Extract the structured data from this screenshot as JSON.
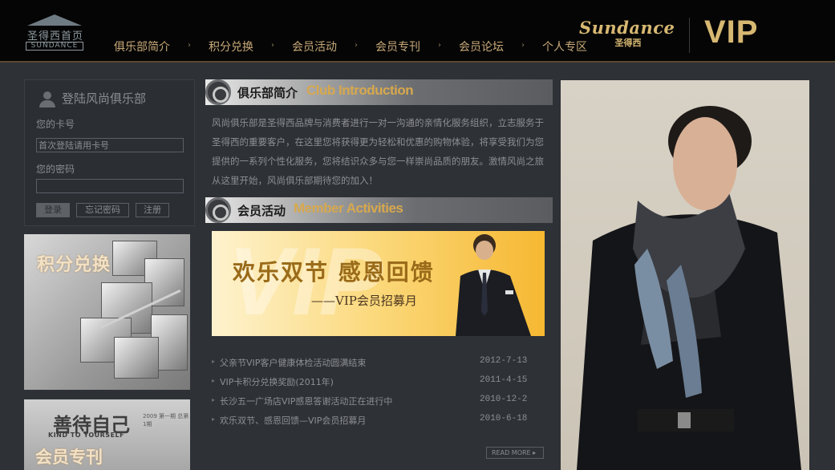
{
  "header": {
    "logo": {
      "cn": "圣得西首页",
      "en": "SUNDANCE"
    },
    "nav": [
      "俱乐部简介",
      "积分兑换",
      "会员活动",
      "会员专刊",
      "会员论坛",
      "个人专区"
    ],
    "nav_separator": "›",
    "brand": {
      "script": "Sundance",
      "sub": "圣得西"
    },
    "vip": "VIP"
  },
  "login": {
    "title": "登陆风尚俱乐部",
    "card_label": "您的卡号",
    "card_placeholder": "首次登陆请用卡号",
    "password_label": "您的密码",
    "login_button": "登录",
    "forgot_button": "忘记密码",
    "register_button": "注册"
  },
  "left_banners": {
    "points": "积分兑换",
    "magazine": {
      "big": "善待自己",
      "kind": "KIND TO YOURSELF",
      "issue": "2009 第一期 总第1期",
      "title": "会员专刊"
    }
  },
  "club_intro": {
    "cn": "俱乐部简介",
    "en": "Club Introduction",
    "text": "风尚俱乐部是圣得西品牌与消费者进行一对一沟通的亲情化服务组织，立志服务于圣得西的重要客户，在这里您将获得更为轻松和优惠的购物体验，将享受我们为您提供的一系列个性化服务，您将结识众多与您一样崇尚品质的朋友。激情风尚之旅从这里开始，风尚俱乐部期待您的加入！"
  },
  "member_activities": {
    "cn": "会员活动",
    "en": "Member Activities",
    "banner": {
      "main": "欢乐双节  感恩回馈",
      "sub": "——VIP会员招募月",
      "bg": "VIP"
    }
  },
  "news": [
    {
      "title": "父亲节VIP客户健康体检活动圆满结束",
      "date": "2012-7-13"
    },
    {
      "title": "VIP卡积分兑换奖励(2011年)",
      "date": "2011-4-15"
    },
    {
      "title": "长沙五一广场店VIP感恩答谢活动正在进行中",
      "date": "2010-12-2"
    },
    {
      "title": "欢乐双节、感恩回馈—VIP会员招募月",
      "date": "2010-6-18"
    }
  ],
  "read_more": "READ MORE ▸",
  "colors": {
    "gold": "#d7b872",
    "accent": "#d7a84d",
    "bg": "#2e3136"
  }
}
